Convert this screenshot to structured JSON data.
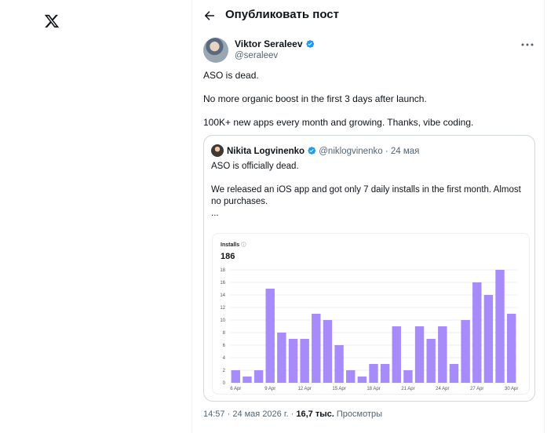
{
  "sidebar": {
    "logo_icon": "x-logo-icon"
  },
  "header": {
    "title": "Опубликовать пост",
    "back_icon": "arrow-left-icon"
  },
  "tweet": {
    "author_name": "Viktor Seraleev",
    "author_handle": "@seraleev",
    "paragraphs": [
      "ASO is dead.",
      "No more organic boost in the first 3 days after launch.",
      "100K+ new apps every month and growing. Thanks, vibe coding."
    ],
    "time": "14:57",
    "date": "24 мая 2026 г.",
    "views": "16,7 тыс.",
    "views_label": "Просмотры",
    "separator": "·"
  },
  "quote": {
    "author_name": "Nikita Logvinenko",
    "author_handle": "@niklogvinenko",
    "date": "24 мая",
    "separator": "·",
    "paragraphs": [
      "ASO is officially dead.",
      "We released an iOS app and got only 7 daily installs in the first month. Almost no purchases.",
      "..."
    ]
  },
  "chart_data": {
    "type": "bar",
    "title": "Installs",
    "total": "186",
    "values": [
      2,
      1,
      2,
      15,
      8,
      7,
      7,
      11,
      10,
      6,
      2,
      1,
      3,
      3,
      9,
      2,
      9,
      7,
      9,
      3,
      10,
      16,
      14,
      18,
      11
    ],
    "x_tick_labels": [
      "6 Apr",
      "9 Apr",
      "12 Apr",
      "15 Apr",
      "18 Apr",
      "21 Apr",
      "24 Apr",
      "27 Apr",
      "30 Apr"
    ],
    "x_tick_indices": [
      0,
      3,
      6,
      9,
      12,
      15,
      18,
      21,
      24
    ],
    "y_ticks": [
      0,
      2,
      4,
      6,
      8,
      10,
      12,
      14,
      16,
      18
    ],
    "ylim": [
      0,
      18
    ],
    "grid": true,
    "bar_color": "#a78bfa"
  },
  "colors": {
    "verified": "#1d9bf0",
    "secondary_text": "#536471"
  }
}
